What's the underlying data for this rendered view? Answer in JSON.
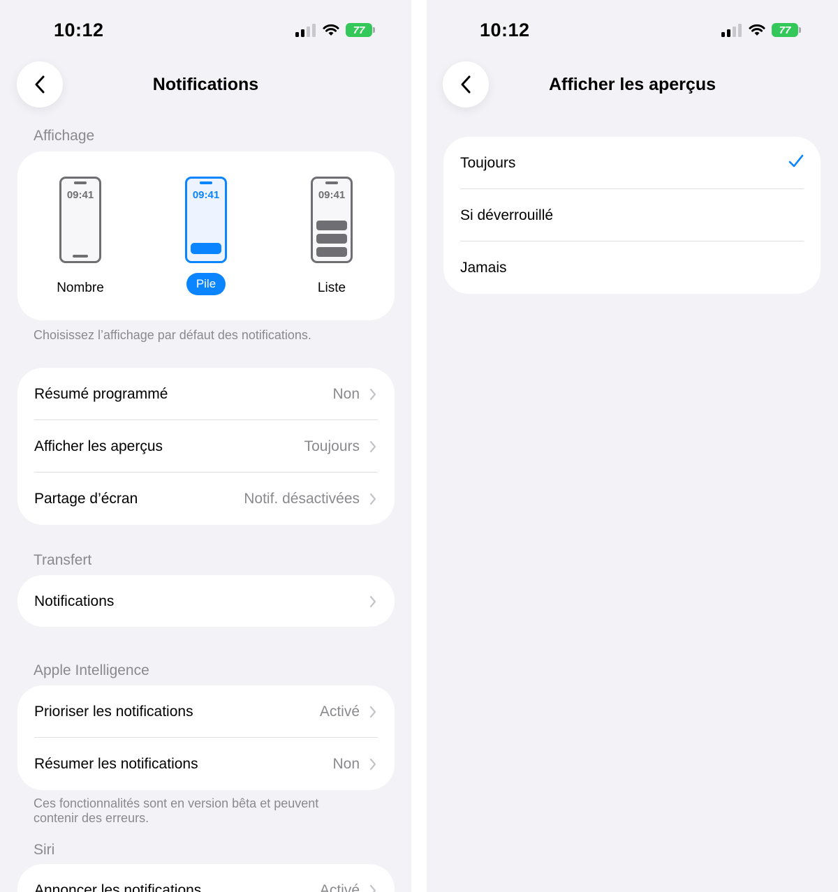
{
  "left": {
    "status_time": "10:12",
    "battery": "77",
    "nav_title": "Notifications",
    "display": {
      "header": "Affichage",
      "options": [
        {
          "label": "Nombre",
          "clock": "09:41",
          "selected": false
        },
        {
          "label": "Pile",
          "clock": "09:41",
          "selected": true
        },
        {
          "label": "Liste",
          "clock": "09:41",
          "selected": false
        }
      ],
      "footnote": "Choisissez l’affichage par défaut des notifications."
    },
    "main_rows": [
      {
        "label": "Résumé programmé",
        "value": "Non"
      },
      {
        "label": "Afficher les aperçus",
        "value": "Toujours"
      },
      {
        "label": "Partage d’écran",
        "value": "Notif. désactivées"
      }
    ],
    "transfer": {
      "header": "Transfert",
      "rows": [
        {
          "label": "Notifications",
          "value": ""
        }
      ]
    },
    "ai": {
      "header": "Apple Intelligence",
      "rows": [
        {
          "label": "Prioriser les notifications",
          "value": "Activé"
        },
        {
          "label": "Résumer les notifications",
          "value": "Non"
        }
      ],
      "footnote_line1": "Ces fonctionnalités sont en version bêta et peuvent",
      "footnote_line2": "contenir des erreurs."
    },
    "siri": {
      "header": "Siri",
      "rows": [
        {
          "label": "Annoncer les notifications",
          "value": "Activé"
        }
      ]
    }
  },
  "right": {
    "status_time": "10:12",
    "battery": "77",
    "nav_title": "Afficher les aperçus",
    "options": [
      {
        "label": "Toujours",
        "checked": true
      },
      {
        "label": "Si déverrouillé",
        "checked": false
      },
      {
        "label": "Jamais",
        "checked": false
      }
    ]
  },
  "colors": {
    "accent": "#0a84ff",
    "background": "#f2f2f7",
    "secondary_text": "#8a8a8e",
    "battery": "#34c759"
  },
  "icons": [
    "signal-icon",
    "wifi-icon",
    "battery-icon",
    "chevron-left-icon",
    "chevron-right-icon",
    "checkmark-icon"
  ]
}
